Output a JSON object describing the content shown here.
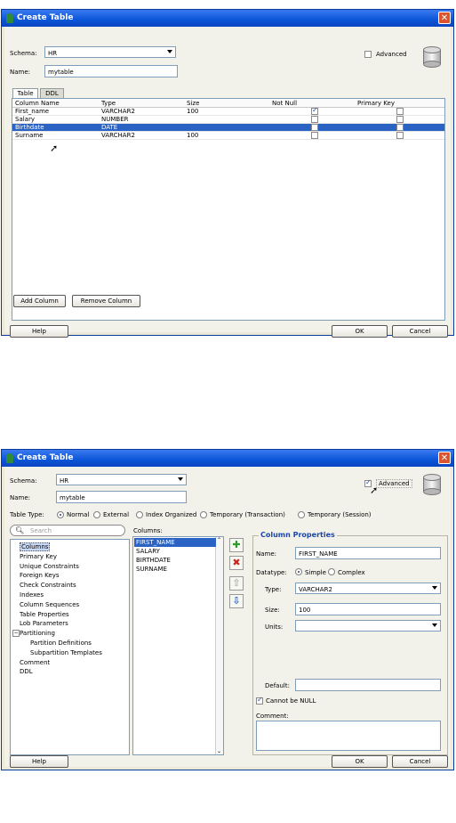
{
  "dialog1": {
    "title": "Create Table",
    "schema_label": "Schema:",
    "schema_value": "HR",
    "name_label": "Name:",
    "name_value": "mytable",
    "advanced_label": "Advanced",
    "advanced_checked": false,
    "tabs": [
      "Table",
      "DDL"
    ],
    "columns_header": [
      "Column Name",
      "Type",
      "Size",
      "Not Null",
      "Primary Key"
    ],
    "rows": [
      {
        "name": "First_name",
        "type": "VARCHAR2",
        "size": "100",
        "not_null": true,
        "primary_key": false,
        "selected": false
      },
      {
        "name": "Salary",
        "type": "NUMBER",
        "size": "",
        "not_null": false,
        "primary_key": false,
        "selected": false
      },
      {
        "name": "Birthdate",
        "type": "DATE",
        "size": "",
        "not_null": false,
        "primary_key": false,
        "selected": true
      },
      {
        "name": "Surname",
        "type": "VARCHAR2",
        "size": "100",
        "not_null": false,
        "primary_key": false,
        "selected": false
      }
    ],
    "add_column_label": "Add Column",
    "remove_column_label": "Remove Column",
    "help_label": "Help",
    "ok_label": "OK",
    "cancel_label": "Cancel"
  },
  "dialog2": {
    "title": "Create Table",
    "schema_label": "Schema:",
    "schema_value": "HR",
    "name_label": "Name:",
    "name_value": "mytable",
    "advanced_label": "Advanced",
    "advanced_checked": true,
    "table_type_label": "Table Type:",
    "table_types": [
      {
        "label": "Normal",
        "selected": true
      },
      {
        "label": "External",
        "selected": false
      },
      {
        "label": "Index Organized",
        "selected": false
      },
      {
        "label": "Temporary (Transaction)",
        "selected": false
      },
      {
        "label": "Temporary (Session)",
        "selected": false
      }
    ],
    "search_placeholder": "Search",
    "tree": [
      {
        "label": "Columns",
        "level": 0,
        "selected": true
      },
      {
        "label": "Primary Key",
        "level": 0
      },
      {
        "label": "Unique Constraints",
        "level": 0
      },
      {
        "label": "Foreign Keys",
        "level": 0
      },
      {
        "label": "Check Constraints",
        "level": 0
      },
      {
        "label": "Indexes",
        "level": 0
      },
      {
        "label": "Column Sequences",
        "level": 0
      },
      {
        "label": "Table Properties",
        "level": 0
      },
      {
        "label": "Lob Parameters",
        "level": 0
      },
      {
        "label": "Partitioning",
        "level": 0,
        "expander": "−"
      },
      {
        "label": "Partition Definitions",
        "level": 1
      },
      {
        "label": "Subpartition Templates",
        "level": 1
      },
      {
        "label": "Comment",
        "level": 0
      },
      {
        "label": "DDL",
        "level": 0
      }
    ],
    "columns_label": "Columns:",
    "columns_list": [
      "FIRST_NAME",
      "SALARY",
      "BIRTHDATE",
      "SURNAME"
    ],
    "column_properties_title": "Column Properties",
    "cp_name_label": "Name:",
    "cp_name_value": "FIRST_NAME",
    "datatype_label": "Datatype:",
    "datatype_simple": "Simple",
    "datatype_complex": "Complex",
    "type_label": "Type:",
    "type_value": "VARCHAR2",
    "size_label": "Size:",
    "size_value": "100",
    "units_label": "Units:",
    "units_value": "",
    "default_label": "Default:",
    "default_value": "",
    "cannot_be_null_label": "Cannot be NULL",
    "cannot_be_null_checked": true,
    "comment_label": "Comment:",
    "comment_value": "",
    "help_label": "Help",
    "ok_label": "OK",
    "cancel_label": "Cancel"
  },
  "colors": {
    "title_bar": "#0b55d8",
    "selection": "#2b63c4",
    "accent_blue_label": "#1c47a8",
    "add_green": "#2c9a2c",
    "remove_red": "#c8281e"
  }
}
